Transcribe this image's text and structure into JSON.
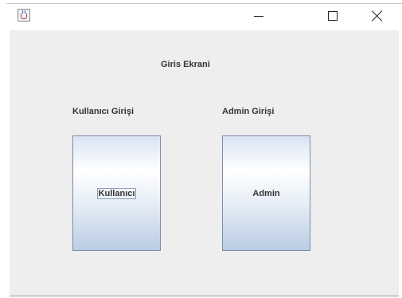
{
  "window": {
    "icon": "java-cup-icon",
    "controls": {
      "minimize": "minimize-icon",
      "maximize": "maximize-icon",
      "close": "close-icon"
    }
  },
  "main": {
    "title": "Giris Ekrani",
    "user_section_label": "Kullanıcı Girişi",
    "admin_section_label": "Admin Girişi",
    "user_button_label": "Kullanıcı",
    "admin_button_label": "Admin"
  }
}
